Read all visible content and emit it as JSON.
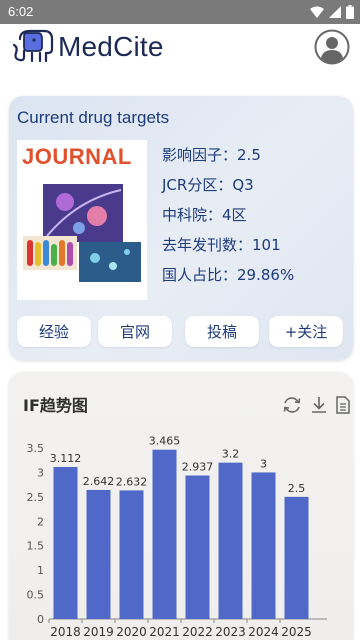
{
  "status_bar": {
    "time": "6:02"
  },
  "app": {
    "brand": "MedCite"
  },
  "journal": {
    "name": "Current drug targets",
    "cover_title": "JOURNAL",
    "info": [
      {
        "label": "影响因子：",
        "value": "2.5"
      },
      {
        "label": "JCR分区：",
        "value": "Q3"
      },
      {
        "label": "中科院：",
        "value": "4区"
      },
      {
        "label": "去年发刊数：",
        "value": "101"
      },
      {
        "label": "国人占比：",
        "value": "29.86%"
      }
    ],
    "actions": {
      "experience": "经验",
      "website": "官网",
      "submit": "投稿",
      "follow": "+关注"
    }
  },
  "trend": {
    "title": "IF趋势图",
    "tools": [
      "refresh-icon",
      "download-icon",
      "document-icon"
    ]
  },
  "colors": {
    "bar": "#5068c8",
    "brand": "#1d2a57",
    "accent_text": "#1e3b7a"
  },
  "chart_data": {
    "type": "bar",
    "title": "IF趋势图",
    "categories": [
      "2018",
      "2019",
      "2020",
      "2021",
      "2022",
      "2023",
      "2024",
      "2025"
    ],
    "values": [
      3.112,
      2.642,
      2.632,
      3.465,
      2.937,
      3.2,
      3,
      2.5
    ],
    "data_labels": [
      "3.112",
      "2.642",
      "2.632",
      "3.465",
      "2.937",
      "3.2",
      "3",
      "2.5"
    ],
    "yticks": [
      "0",
      "0.5",
      "1",
      "1.5",
      "2",
      "2.5",
      "3",
      "3.5"
    ],
    "ylim": [
      0,
      3.5
    ],
    "grid": false
  }
}
